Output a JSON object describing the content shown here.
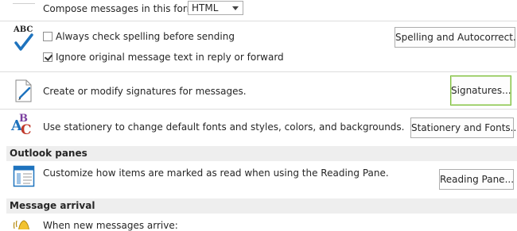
{
  "mail_format": {
    "compose_label": "Compose messages in this format:",
    "format_value": "HTML"
  },
  "spelling": {
    "always_check_label": "Always check spelling before sending",
    "always_check_checked": false,
    "ignore_original_label": "Ignore original message text in reply or forward",
    "ignore_original_checked": true,
    "button_label": "Spelling and Autocorrect..."
  },
  "signatures": {
    "description": "Create or modify signatures for messages.",
    "button_label": "Signatures..."
  },
  "stationery": {
    "description": "Use stationery to change default fonts and styles, colors, and backgrounds.",
    "button_label": "Stationery and Fonts..."
  },
  "outlook_panes": {
    "section_title": "Outlook panes",
    "description": "Customize how items are marked as read when using the Reading Pane.",
    "button_label": "Reading Pane..."
  },
  "message_arrival": {
    "section_title": "Message arrival",
    "description": "When new messages arrive:"
  },
  "icons": {
    "abc": "ABC",
    "stationery_letters": "ABC"
  },
  "colors": {
    "accent_blue": "#1e73be",
    "focus_green": "#7fbf3f",
    "section_bg": "#eeeeee"
  }
}
